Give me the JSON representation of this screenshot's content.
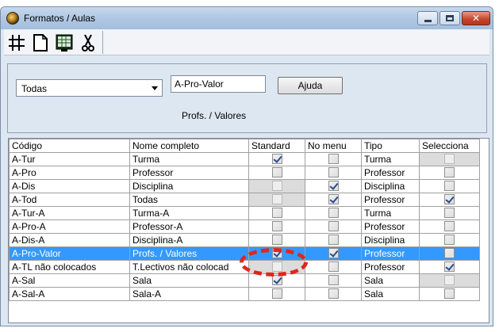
{
  "window": {
    "title": "Formatos / Aulas",
    "icon": "clock-icon",
    "controls": [
      "minimize-icon",
      "maximize-icon",
      "close-icon"
    ]
  },
  "toolbar": {
    "tools": [
      "grid-icon",
      "new-document-icon",
      "spreadsheet-icon",
      "scissors-icon"
    ]
  },
  "filter": {
    "combo_value": "Todas",
    "text_value": "A-Pro-Valor",
    "help_label": "Ajuda",
    "caption": "Profs. / Valores"
  },
  "table": {
    "headers": [
      "Código",
      "Nome completo",
      "Standard",
      "No menu",
      "Tipo",
      "Selecciona"
    ],
    "rows": [
      {
        "codigo": "A-Tur",
        "nome": "Turma",
        "standard": true,
        "standard_disabled": false,
        "nomenu": false,
        "tipo": "Turma",
        "selecciona": false,
        "selecciona_disabled": true
      },
      {
        "codigo": "A-Pro",
        "nome": "Professor",
        "standard": false,
        "standard_disabled": false,
        "nomenu": false,
        "tipo": "Professor",
        "selecciona": false,
        "selecciona_disabled": false
      },
      {
        "codigo": "A-Dis",
        "nome": "Disciplina",
        "standard": false,
        "standard_disabled": true,
        "nomenu": true,
        "tipo": "Disciplina",
        "selecciona": false,
        "selecciona_disabled": false
      },
      {
        "codigo": "A-Tod",
        "nome": "Todas",
        "standard": false,
        "standard_disabled": true,
        "nomenu": true,
        "tipo": "Professor",
        "selecciona": true,
        "selecciona_disabled": false
      },
      {
        "codigo": "A-Tur-A",
        "nome": "Turma-A",
        "standard": false,
        "standard_disabled": false,
        "nomenu": false,
        "tipo": "Turma",
        "selecciona": false,
        "selecciona_disabled": false
      },
      {
        "codigo": "A-Pro-A",
        "nome": "Professor-A",
        "standard": false,
        "standard_disabled": false,
        "nomenu": false,
        "tipo": "Professor",
        "selecciona": false,
        "selecciona_disabled": false
      },
      {
        "codigo": "A-Dis-A",
        "nome": "Disciplina-A",
        "standard": false,
        "standard_disabled": false,
        "nomenu": false,
        "tipo": "Disciplina",
        "selecciona": false,
        "selecciona_disabled": false
      },
      {
        "codigo": "A-Pro-Valor",
        "nome": "Profs. / Valores",
        "standard": true,
        "standard_disabled": false,
        "nomenu": true,
        "tipo": "Professor",
        "selecciona": false,
        "selecciona_disabled": false,
        "selected": true
      },
      {
        "codigo": "A-TL não colocados",
        "nome": "T.Lectivos não colocad",
        "standard": false,
        "standard_disabled": true,
        "nomenu": false,
        "tipo": "Professor",
        "selecciona": true,
        "selecciona_disabled": false
      },
      {
        "codigo": "A-Sal",
        "nome": "Sala",
        "standard": true,
        "standard_disabled": false,
        "nomenu": false,
        "tipo": "Sala",
        "selecciona": false,
        "selecciona_disabled": true
      },
      {
        "codigo": "A-Sal-A",
        "nome": "Sala-A",
        "standard": false,
        "standard_disabled": false,
        "nomenu": false,
        "tipo": "Sala",
        "selecciona": false,
        "selecciona_disabled": false
      }
    ]
  },
  "colors": {
    "selection": "#3399ff",
    "highlight_ring": "#e1261c",
    "titlebar": "#aec6e2"
  }
}
